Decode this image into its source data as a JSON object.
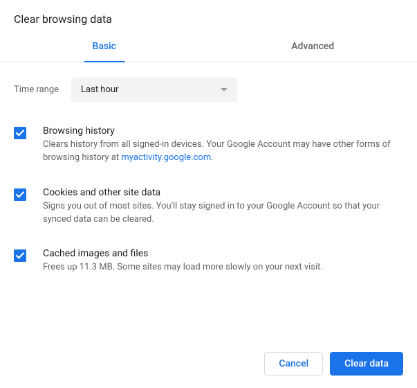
{
  "title": "Clear browsing data",
  "tabs": {
    "basic": "Basic",
    "advanced": "Advanced"
  },
  "time_range": {
    "label": "Time range",
    "value": "Last hour"
  },
  "options": {
    "history": {
      "title": "Browsing history",
      "desc_pre": "Clears history from all signed-in devices. Your Google Account may have other forms of browsing history at ",
      "link_text": "myactivity.google.com",
      "desc_post": "."
    },
    "cookies": {
      "title": "Cookies and other site data",
      "desc": "Signs you out of most sites. You'll stay signed in to your Google Account so that your synced data can be cleared."
    },
    "cache": {
      "title": "Cached images and files",
      "desc": "Frees up 11.3 MB. Some sites may load more slowly on your next visit."
    }
  },
  "buttons": {
    "cancel": "Cancel",
    "clear": "Clear data"
  }
}
